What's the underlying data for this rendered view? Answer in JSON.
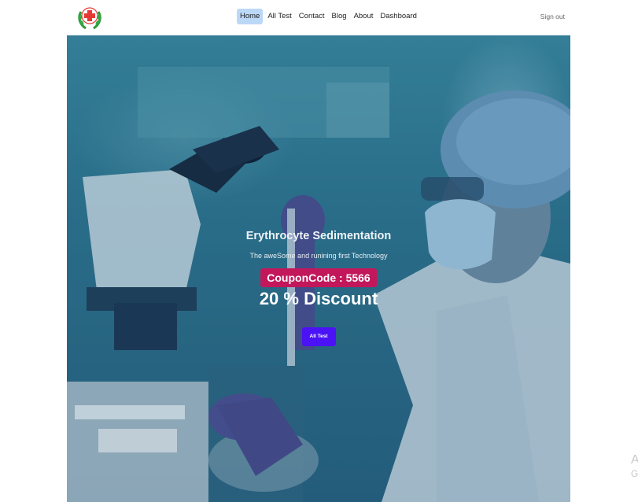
{
  "nav": {
    "links": [
      "Home",
      "All Test",
      "Contact",
      "Blog",
      "About",
      "Dashboard"
    ],
    "active": "Home",
    "signout": "Sign out"
  },
  "hero": {
    "title": "Erythrocyte Sedimentation",
    "subtitle": "The aweSome and runining first Technology",
    "coupon": "CouponCode : 5566",
    "discount": "20 % Discount",
    "cta": "All Test"
  },
  "watermark": {
    "line1": "A",
    "line2": "G"
  },
  "colors": {
    "nav_active_bg": "#bcd8f7",
    "coupon_bg": "#c2185b",
    "cta_bg": "#4a12f5",
    "logo_red": "#e53935",
    "logo_green": "#2e9a3a"
  },
  "icons": {
    "logo": "medical-cross-laurel-icon"
  }
}
